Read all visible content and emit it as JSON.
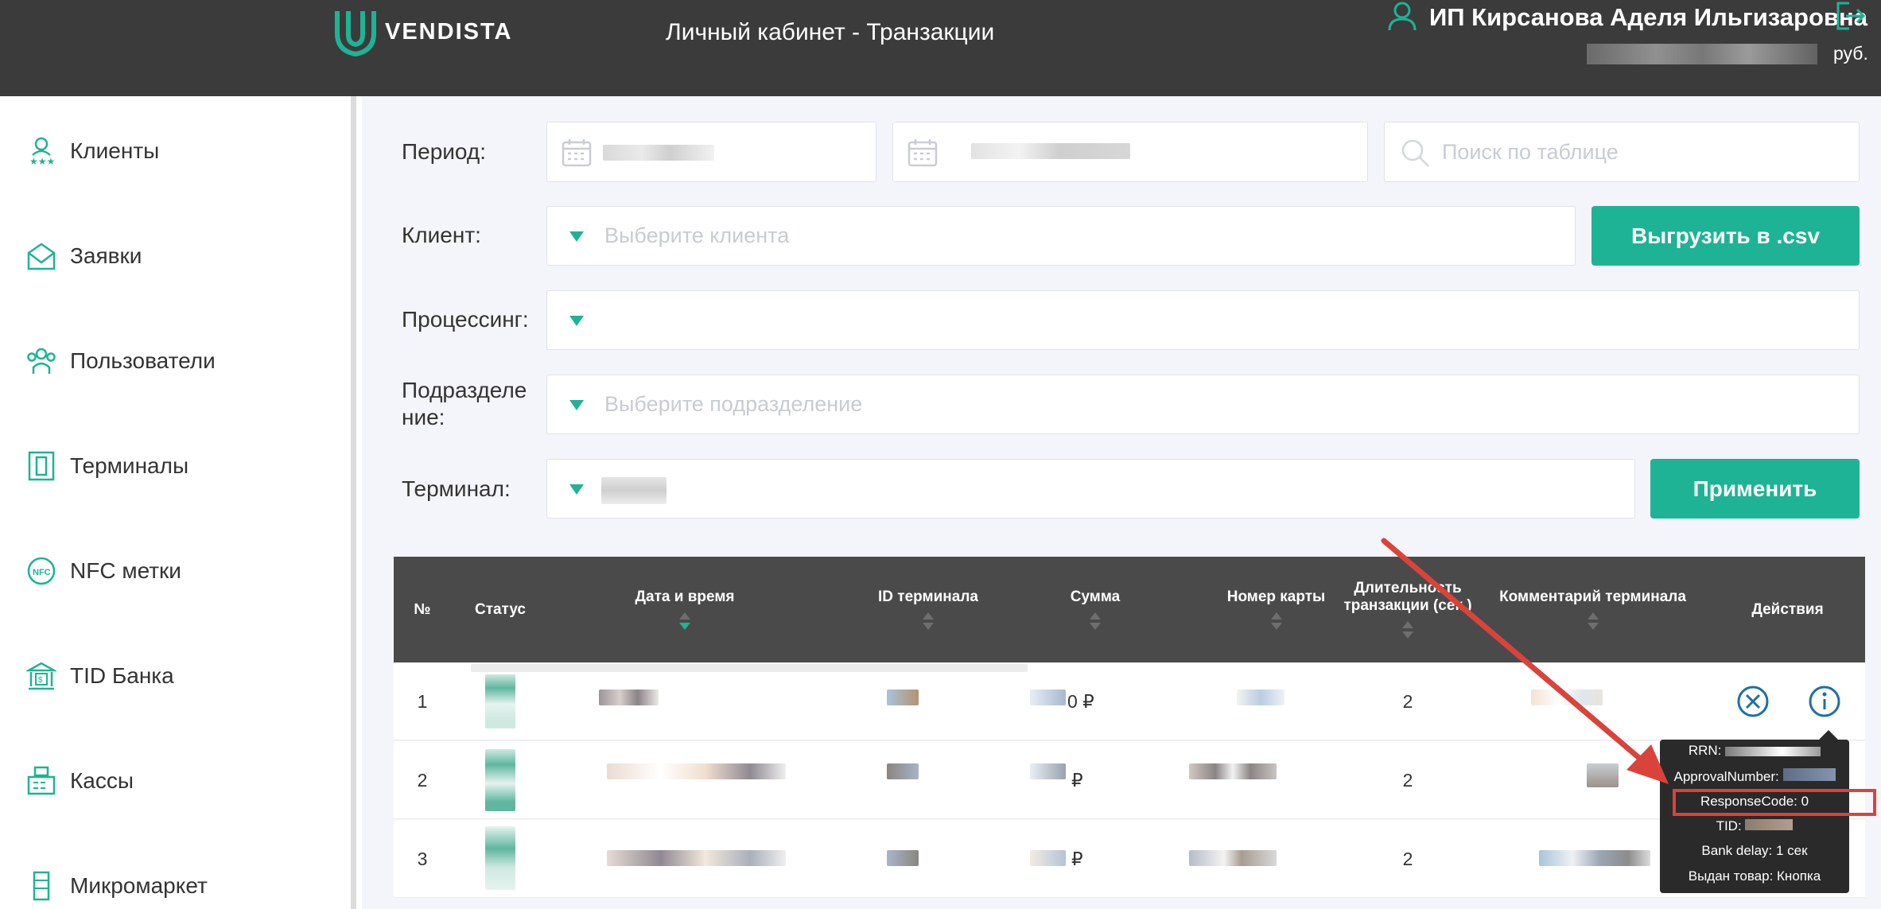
{
  "header": {
    "logo_text": "VENDISTA",
    "page_title": "Личный кабинет - Транзакции",
    "user_name": "ИП Кирсанова Аделя Ильгизаровна",
    "balance_currency": "руб."
  },
  "sidebar": {
    "items": [
      {
        "label": "Клиенты",
        "icon": "clients-icon"
      },
      {
        "label": "Заявки",
        "icon": "envelope-icon"
      },
      {
        "label": "Пользователи",
        "icon": "users-icon"
      },
      {
        "label": "Терминалы",
        "icon": "terminal-icon"
      },
      {
        "label": "NFC метки",
        "icon": "nfc-icon"
      },
      {
        "label": "TID Банка",
        "icon": "bank-icon"
      },
      {
        "label": "Кассы",
        "icon": "cash-register-icon"
      },
      {
        "label": "Микромаркет",
        "icon": "micromarket-icon"
      }
    ]
  },
  "filters": {
    "period_label": "Период:",
    "search_placeholder": "Поиск по таблице",
    "client_label": "Клиент:",
    "client_placeholder": "Выберите клиента",
    "export_button": "Выгрузить в .csv",
    "processing_label": "Процессинг:",
    "division_label": "Подразделе\nние:",
    "division_placeholder": "Выберите подразделение",
    "terminal_label": "Терминал:",
    "apply_button": "Применить"
  },
  "table": {
    "columns": [
      "№",
      "Статус",
      "Дата и время",
      "ID терминала",
      "Сумма",
      "Номер карты",
      "Длительность транзакции (сек.)",
      "Комментарий терминала",
      "Действия"
    ],
    "rows": [
      {
        "num": "1",
        "amount_suffix": "0 ₽",
        "duration": "2"
      },
      {
        "num": "2",
        "amount_suffix": "₽",
        "duration": "2"
      },
      {
        "num": "3",
        "amount_suffix": "₽",
        "duration": "2"
      }
    ]
  },
  "tooltip": {
    "rrn": "RRN:",
    "approval": "ApprovalNumber:",
    "response_code": "ResponseCode: 0",
    "tid": "TID:",
    "bank_delay": "Bank delay: 1 сек",
    "goods_issued": "Выдан товар: Кнопка"
  },
  "colors": {
    "accent": "#1eb394",
    "header_bg": "#3b3b3b",
    "table_head_bg": "#4a4a4a",
    "annotation_red": "#d9433b"
  }
}
